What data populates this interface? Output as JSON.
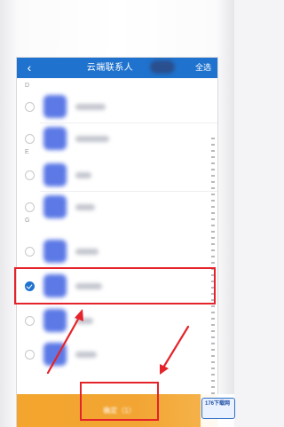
{
  "header": {
    "back_icon": "chevron-left-icon",
    "title": "云端联系人",
    "select_all": "全选"
  },
  "sections": [
    "D",
    "E",
    "G"
  ],
  "contacts": [
    {
      "checked": false
    },
    {
      "checked": false
    },
    {
      "checked": false
    },
    {
      "checked": false
    },
    {
      "checked": false
    },
    {
      "checked": true
    },
    {
      "checked": false
    },
    {
      "checked": false
    }
  ],
  "footer": {
    "confirm_label": "确定（1）"
  },
  "watermark": {
    "text": "176下载网"
  },
  "colors": {
    "nav_blue": "#1f73ce",
    "confirm_orange": "#f2a533",
    "highlight_red": "#e5232a"
  }
}
